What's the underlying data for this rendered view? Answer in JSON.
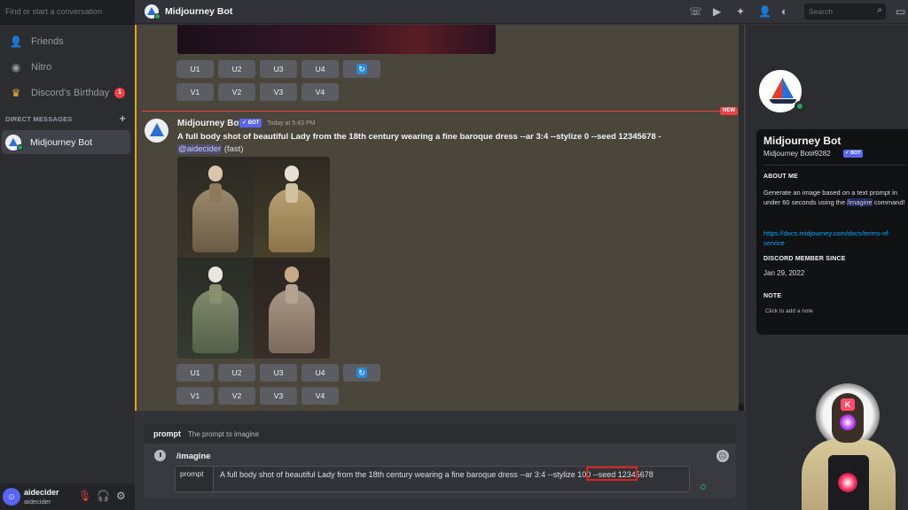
{
  "sidebar": {
    "search_placeholder": "Find or start a conversation",
    "nav": [
      {
        "label": "Friends",
        "icon": "friends-icon"
      },
      {
        "label": "Nitro",
        "icon": "nitro-icon"
      },
      {
        "label": "Discord's Birthday",
        "icon": "birthday-icon",
        "badge": "1"
      }
    ],
    "dm_header": "DIRECT MESSAGES",
    "dm_add": "+",
    "dms": [
      {
        "label": "Midjourney Bot"
      }
    ],
    "user": {
      "name": "aidecider",
      "tag": "aidecider"
    }
  },
  "header": {
    "title": "Midjourney Bot",
    "search_placeholder": "Search"
  },
  "messages": {
    "buttons_row_u": [
      "U1",
      "U2",
      "U3",
      "U4"
    ],
    "buttons_row_v": [
      "V1",
      "V2",
      "V3",
      "V4"
    ],
    "new_badge": "NEW",
    "message": {
      "author": "Midjourney Bot",
      "bot_tag": "✓ BOT",
      "time": "Today at 5:43 PM",
      "prompt": "A full body shot of beautiful Lady from the 18th century wearing a fine baroque dress --ar 3:4 --stylize 0 --seed 12345678 -",
      "mention": "@aidecider",
      "suffix": "(fast)"
    }
  },
  "input": {
    "hint_label": "prompt",
    "hint_desc": "The prompt to imagine",
    "command": "/imagine",
    "param_label": "prompt",
    "param_value": "A full body shot of beautiful Lady from the 18th century wearing a fine baroque dress --ar 3:4 --stylize 100 --seed 12345678"
  },
  "profile": {
    "name": "Midjourney Bot",
    "tag": "Midjourney Bot#9282",
    "bot_tag": "✓ BOT",
    "about_header": "ABOUT ME",
    "about_pre": "Generate an image based on a text prompt in under 60 seconds using the ",
    "about_cmd": "/imagine",
    "about_post": " command!",
    "link": "https://docs.midjourney.com/docs/terms-of-service",
    "member_header": "DISCORD MEMBER SINCE",
    "member_date": "Jan 29, 2022",
    "note_header": "NOTE",
    "note_hint": "Click to add a note"
  },
  "overlay": {
    "letter": "K"
  },
  "colors": {
    "accent": "#5865f2",
    "new": "#f23f43",
    "online": "#23a55a",
    "highlight": "#e0a520",
    "link": "#00a8fc"
  }
}
